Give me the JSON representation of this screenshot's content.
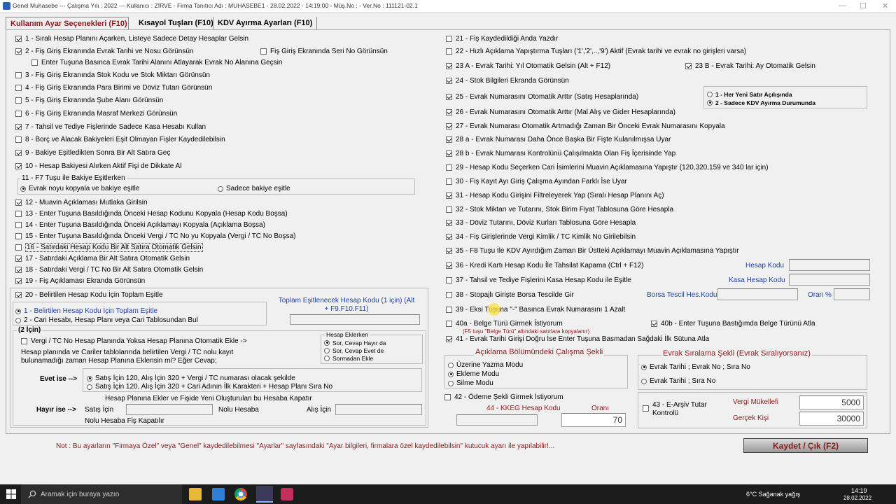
{
  "window": {
    "title": "Genel Muhasebe  ---  Çalışma Yılı : 2022  ---  Kullanıcı : ZİRVE - Firma Tanıtıcı Adı : MUHASEBE1 - 28.02.2022 - 14:19:00 - Müş.No : - Ver.No : 111121-02.1"
  },
  "tabs": [
    "Kullanım Ayar Seçenekleri (F10)",
    "Kısayol Tuşları (F10)",
    "KDV Ayırma Ayarları  (F10)"
  ],
  "left": {
    "o1": "1 -  Sıralı Hesap Planını Açarken, Listeye Sadece Detay Hesaplar Gelsin",
    "o2": "2 - Fiş Giriş Ekranında Evrak Tarihi ve Nosu Görünsün",
    "o2b": "Fiş Giriş Ekranında Seri No Görünsün",
    "o2c": "Enter Tuşuna Basınca Evrak Tarihi Alanını Atlayarak Evrak No Alanına Geçsin",
    "o3": "3 - Fiş Giriş Ekranında Stok Kodu ve Stok Miktarı Görünsün",
    "o4": "4 - Fiş Giriş Ekranında Para Birimi ve Döviz Tutarı Görünsün",
    "o5": "5 - Fiş Giriş Ekranında Şube Alanı Görünsün",
    "o6": "6 - Fiş Giriş Ekranında Masraf Merkezi Görünsün",
    "o7": "7 - Tahsil ve Tediye Fişlerinde Sadece Kasa Hesabı Kullan",
    "o8": "8 - Borç ve Alacak Bakiyeleri Eşit Olmayan Fişler Kaydedilebilsin",
    "o9": "9 - Bakiye Eşitledikten Sonra Bir Alt Satıra Geç",
    "o10": "10 - Hesap Bakiyesi Alırken Aktif Fişi de Dikkate Al",
    "g11": "11 - F7 Tuşu ile Bakiye  Eşitlerken",
    "g11a": "Evrak noyu kopyala ve bakiye eşitle",
    "g11b": "Sadece bakiye eşitle",
    "o12": "12 - Muavin Açıklaması Mutlaka Girilsin",
    "o13": "13 - Enter Tuşuna Basıldığında Önceki Hesap Kodunu Kopyala (Hesap Kodu Boşsa)",
    "o14": "14 - Enter Tuşuna Basıldığında Önceki Açıklamayı Kopyala (Açıklama Boşsa)",
    "o15": "15 - Enter Tuşuna Basıldığında Önceki Vergi / TC No yu Kopyala (Vergi / TC No Boşsa)",
    "o16": "16 - Satırdaki Hesap Kodu Bir Alt Satıra Otomatik Gelsin",
    "o17": "17 - Satırdaki Açıklama Bir Alt Satıra Otomatik Gelsin",
    "o18": "18 - Satırdaki Vergi / TC No Bir Alt Satıra Otomatik Gelsin",
    "o19": "19 - Fiş Açıklaması Ekranda Görünsün",
    "o20": "20 - Belirtilen Hesap Kodu İçin Toplam Eşitle",
    "o20a": "1 - Belirtilen Hesap Kodu İçin Toplam Eşitle",
    "o20b": "2 - Cari Hesabı, Hesap Planı veya Cari Tablosundan Bul",
    "toplam_label": "Toplam Eşitlenecek Hesap Kodu (1 için) (Alt + F9.F10.F11)",
    "g2_title": "(2 İçin)",
    "vergi_opt": "Vergi / TC No Hesap Planında Yoksa Hesap Planına Otomatik Ekle ->",
    "hesap_eklerken": "Hesap Eklerken",
    "he1": "Sor, Cevap Hayır da",
    "he2": "Sor, Cevap Evet de",
    "he3": "Sormadan Ekle",
    "question": "Hesap planında ve Cariler tablolarında belirtilen Vergi / TC nolu kayıt bulunamadığı zaman Hesap Planına Eklensin mi? Eğer Cevap;",
    "evet_ise": "Evet ise -->",
    "evet1": "Satış İçin 120, Alış İçin 320 + Vergi / TC numarası olacak şekilde",
    "evet2": "Satış İçin 120, Alış İçin 320 + Cari Adının İlk Karakteri + Hesap Planı Sıra No",
    "hayir_title": "Hesap Planına Ekler ve Fişide Yeni Oluşturulan bu Hesaba Kapatır",
    "hayir_ise": "Hayır ise -->",
    "satis_icin": "Satış İçin",
    "nolu_hesaba": "Nolu Hesaba",
    "alis_icin": "Alış İçin",
    "nolu_kapatir": "Nolu Hesaba Fiş Kapatılır"
  },
  "right": {
    "o21": "21 - Fiş Kaydedildiği Anda Yazdır",
    "o22": "22 - Hızlı Açıklama Yapıştırma Tuşları ('1','2',..,'9') Aktif (Evrak tarihi ve evrak no girişleri varsa)",
    "o23a": "23 A - Evrak Tarihi: Yıl Otomatik Gelsin (Alt + F12)",
    "o23b": "23 B - Evrak Tarihi: Ay Otomatik Gelsin",
    "o24": "24 - Stok Bilgileri Ekranda Görünsün",
    "o25": "25 - Evrak Numarasını Otomatik Arttır (Satış Hesaplarında)",
    "r25a": "1 - Her Yeni Satır Açılışında",
    "r25b": "2 - Sadece KDV Ayırma Durumunda",
    "o26": "26 - Evrak Numarasını Otomatik Arttır (Mal Alış ve Gider Hesaplarında)",
    "o27": "27 - Evrak Numarası Otomatik Artmadığı Zaman Bir Önceki Evrak Numarasını Kopyala",
    "o28a": "28 a - Evrak Numarası Daha Önce Başka Bir Fişte Kulanılmışsa Uyar",
    "o28b": "28 b - Evrak Numarası Kontrolünü Çalışılmakta Olan Fiş İçerisinde Yap",
    "o29": "29 - Hesap Kodu Seçerken Cari İsimlerini Muavin Açıklamasına Yapıştır (120,320,159 ve 340 lar için)",
    "o30": "30 - Fiş Kayıt Ayı Giriş Çalışma Ayından Farklı İse Uyar",
    "o31": "31 - Hesap Kodu Girişini Filtreleyerek Yap (Sıralı Hesap Planını Aç)",
    "o32": "32 - Stok Miktarı ve Tutarını, Stok Birim Fiyat Tablosuna Göre Hesapla",
    "o33": "33 - Döviz Tutarını, Döviz Kurları Tablosuna Göre Hesapla",
    "o34": "34 - Fiş Girişlerinde Vergi Kimlik / TC Kimlik No Girilebilsin",
    "o35": "35 - F8 Tuşu İle KDV Ayırdığım Zaman Bir Üstteki Açıklamayı Muavin Açıklamasına Yapıştır",
    "o36": "36 - Kredi Kartı Hesap Kodu İle Tahsilat Kapama (Ctrl + F12)",
    "hesap_kodu": "Hesap Kodu",
    "o37": "37 - Tahsil ve Tediye Fişlerini Kasa Hesap Kodu ile Eşitle",
    "kasa_hesap_kodu": "Kasa Hesap Kodu",
    "o38": "38 - Stopajlı Girişte Borsa Tescilde Gir",
    "borsa_tescil": "Borsa Tescil Hes.Kodu",
    "oran_pct": "Oran %",
    "o39": "39 - Eksi Tuşuna \"-\" Basınca Evrak Numarasını 1 Azalt",
    "o40a": "40a - Belge Türü Girmek İstiyorum",
    "o40a_note": "(F5 tuşu \"Belge Türü\" altındaki satırlara kopyalanır)",
    "o40b": "40b - Enter Tuşuna Bastığımda Belge Türünü Atla",
    "o41": "41 - Evrak Tarihi Girişi Doğru İse Enter Tuşuna Basmadan Sağdaki İlk Sütuna Atla",
    "aciklama_title": "Açıklama Bölümündeki Çalışma Şekli",
    "ac1": "Üzerine Yazma Modu",
    "ac2": "Ekleme Modu",
    "ac3": "Silme Modu",
    "evrak_title": "Evrak Sıralama Şekli (Evrak Sıralıyorsanız)",
    "ev1": "Evrak Tarihi ; Evrak No ; Sıra No",
    "ev2": "Evrak Tarihi ; Sıra No",
    "o42": "42 - Ödeme Şekli Girmek İstiyorum",
    "kkeg_label": "44 - KKEG Hesap Kodu",
    "orani_label": "Oranı",
    "orani_value": "70",
    "o43": "43 - E-Arşiv Tutar Kontrolü",
    "vergi_mukellefi": "Vergi Mükellefi",
    "vergi_mukellefi_value": "5000",
    "gercek_kisi": "Gerçek Kişi",
    "gercek_kisi_value": "30000"
  },
  "footer": {
    "note": "Not : Bu ayarların \"Firmaya Özel\" veya \"Genel\" kaydedilebilmesi \"Ayarlar\" sayfasındaki \"Ayar bilgileri, firmalara özel kaydedilebilsin\" kutucuk ayarı ile yapılabilir!...",
    "save": "Kaydet / Çık (F2)"
  },
  "taskbar": {
    "search_placeholder": "Aramak için buraya yazın",
    "weather": "6°C  Sağanak yağış",
    "time": "14:19",
    "date": "28.02.2022"
  },
  "colors": {
    "accent_red": "#8b1a1a",
    "link_blue": "#1f3fa8",
    "taskbar": "#1c1c1c"
  }
}
